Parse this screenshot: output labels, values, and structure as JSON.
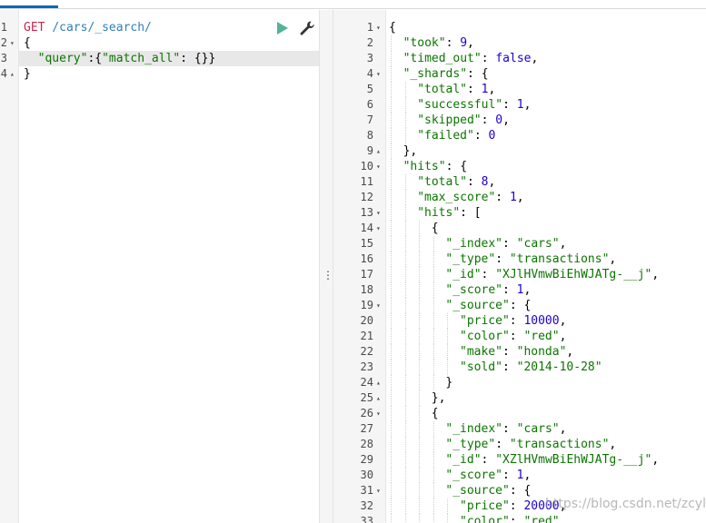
{
  "request_editor": {
    "lines": [
      {
        "num": "1",
        "fold": "",
        "tokens": [
          {
            "t": "GET ",
            "c": "tk-method"
          },
          {
            "t": "/cars/_search/",
            "c": "tk-url"
          }
        ]
      },
      {
        "num": "2",
        "fold": "▾",
        "tokens": [
          {
            "t": "{",
            "c": "tk-punct"
          }
        ]
      },
      {
        "num": "3",
        "fold": "",
        "active": true,
        "tokens": [
          {
            "t": "  ",
            "c": "tk-punct"
          },
          {
            "t": "\"query\"",
            "c": "tk-key"
          },
          {
            "t": ":{",
            "c": "tk-punct"
          },
          {
            "t": "\"match_all\"",
            "c": "tk-key"
          },
          {
            "t": ": {}}",
            "c": "tk-punct"
          }
        ]
      },
      {
        "num": "4",
        "fold": "▴",
        "tokens": [
          {
            "t": "}",
            "c": "tk-punct"
          }
        ]
      }
    ]
  },
  "toolbar": {
    "run_icon": "play-icon",
    "settings_icon": "wrench-icon",
    "run_color": "#54b399"
  },
  "response_viewer": {
    "lines": [
      {
        "num": "1",
        "fold": "▾",
        "indent": 0,
        "tokens": [
          {
            "t": "{",
            "c": "tk-punct"
          }
        ]
      },
      {
        "num": "2",
        "fold": "",
        "indent": 1,
        "tokens": [
          {
            "t": "\"took\"",
            "c": "tk-key"
          },
          {
            "t": ": ",
            "c": "tk-punct"
          },
          {
            "t": "9",
            "c": "tk-num"
          },
          {
            "t": ",",
            "c": "tk-punct"
          }
        ]
      },
      {
        "num": "3",
        "fold": "",
        "indent": 1,
        "tokens": [
          {
            "t": "\"timed_out\"",
            "c": "tk-key"
          },
          {
            "t": ": ",
            "c": "tk-punct"
          },
          {
            "t": "false",
            "c": "tk-bool"
          },
          {
            "t": ",",
            "c": "tk-punct"
          }
        ]
      },
      {
        "num": "4",
        "fold": "▾",
        "indent": 1,
        "tokens": [
          {
            "t": "\"_shards\"",
            "c": "tk-key"
          },
          {
            "t": ": {",
            "c": "tk-punct"
          }
        ]
      },
      {
        "num": "5",
        "fold": "",
        "indent": 2,
        "tokens": [
          {
            "t": "\"total\"",
            "c": "tk-key"
          },
          {
            "t": ": ",
            "c": "tk-punct"
          },
          {
            "t": "1",
            "c": "tk-num"
          },
          {
            "t": ",",
            "c": "tk-punct"
          }
        ]
      },
      {
        "num": "6",
        "fold": "",
        "indent": 2,
        "tokens": [
          {
            "t": "\"successful\"",
            "c": "tk-key"
          },
          {
            "t": ": ",
            "c": "tk-punct"
          },
          {
            "t": "1",
            "c": "tk-num"
          },
          {
            "t": ",",
            "c": "tk-punct"
          }
        ]
      },
      {
        "num": "7",
        "fold": "",
        "indent": 2,
        "tokens": [
          {
            "t": "\"skipped\"",
            "c": "tk-key"
          },
          {
            "t": ": ",
            "c": "tk-punct"
          },
          {
            "t": "0",
            "c": "tk-num"
          },
          {
            "t": ",",
            "c": "tk-punct"
          }
        ]
      },
      {
        "num": "8",
        "fold": "",
        "indent": 2,
        "tokens": [
          {
            "t": "\"failed\"",
            "c": "tk-key"
          },
          {
            "t": ": ",
            "c": "tk-punct"
          },
          {
            "t": "0",
            "c": "tk-num"
          }
        ]
      },
      {
        "num": "9",
        "fold": "▴",
        "indent": 1,
        "tokens": [
          {
            "t": "},",
            "c": "tk-punct"
          }
        ]
      },
      {
        "num": "10",
        "fold": "▾",
        "indent": 1,
        "tokens": [
          {
            "t": "\"hits\"",
            "c": "tk-key"
          },
          {
            "t": ": {",
            "c": "tk-punct"
          }
        ]
      },
      {
        "num": "11",
        "fold": "",
        "indent": 2,
        "tokens": [
          {
            "t": "\"total\"",
            "c": "tk-key"
          },
          {
            "t": ": ",
            "c": "tk-punct"
          },
          {
            "t": "8",
            "c": "tk-num"
          },
          {
            "t": ",",
            "c": "tk-punct"
          }
        ]
      },
      {
        "num": "12",
        "fold": "",
        "indent": 2,
        "tokens": [
          {
            "t": "\"max_score\"",
            "c": "tk-key"
          },
          {
            "t": ": ",
            "c": "tk-punct"
          },
          {
            "t": "1",
            "c": "tk-num"
          },
          {
            "t": ",",
            "c": "tk-punct"
          }
        ]
      },
      {
        "num": "13",
        "fold": "▾",
        "indent": 2,
        "tokens": [
          {
            "t": "\"hits\"",
            "c": "tk-key"
          },
          {
            "t": ": [",
            "c": "tk-punct"
          }
        ]
      },
      {
        "num": "14",
        "fold": "▾",
        "indent": 3,
        "tokens": [
          {
            "t": "{",
            "c": "tk-punct"
          }
        ]
      },
      {
        "num": "15",
        "fold": "",
        "indent": 4,
        "tokens": [
          {
            "t": "\"_index\"",
            "c": "tk-key"
          },
          {
            "t": ": ",
            "c": "tk-punct"
          },
          {
            "t": "\"cars\"",
            "c": "tk-str"
          },
          {
            "t": ",",
            "c": "tk-punct"
          }
        ]
      },
      {
        "num": "16",
        "fold": "",
        "indent": 4,
        "tokens": [
          {
            "t": "\"_type\"",
            "c": "tk-key"
          },
          {
            "t": ": ",
            "c": "tk-punct"
          },
          {
            "t": "\"transactions\"",
            "c": "tk-str"
          },
          {
            "t": ",",
            "c": "tk-punct"
          }
        ]
      },
      {
        "num": "17",
        "fold": "",
        "indent": 4,
        "tokens": [
          {
            "t": "\"_id\"",
            "c": "tk-key"
          },
          {
            "t": ": ",
            "c": "tk-punct"
          },
          {
            "t": "\"XJlHVmwBiEhWJATg-__j\"",
            "c": "tk-str"
          },
          {
            "t": ",",
            "c": "tk-punct"
          }
        ]
      },
      {
        "num": "18",
        "fold": "",
        "indent": 4,
        "tokens": [
          {
            "t": "\"_score\"",
            "c": "tk-key"
          },
          {
            "t": ": ",
            "c": "tk-punct"
          },
          {
            "t": "1",
            "c": "tk-num"
          },
          {
            "t": ",",
            "c": "tk-punct"
          }
        ]
      },
      {
        "num": "19",
        "fold": "▾",
        "indent": 4,
        "tokens": [
          {
            "t": "\"_source\"",
            "c": "tk-key"
          },
          {
            "t": ": {",
            "c": "tk-punct"
          }
        ]
      },
      {
        "num": "20",
        "fold": "",
        "indent": 5,
        "tokens": [
          {
            "t": "\"price\"",
            "c": "tk-key"
          },
          {
            "t": ": ",
            "c": "tk-punct"
          },
          {
            "t": "10000",
            "c": "tk-num"
          },
          {
            "t": ",",
            "c": "tk-punct"
          }
        ]
      },
      {
        "num": "21",
        "fold": "",
        "indent": 5,
        "tokens": [
          {
            "t": "\"color\"",
            "c": "tk-key"
          },
          {
            "t": ": ",
            "c": "tk-punct"
          },
          {
            "t": "\"red\"",
            "c": "tk-str"
          },
          {
            "t": ",",
            "c": "tk-punct"
          }
        ]
      },
      {
        "num": "22",
        "fold": "",
        "indent": 5,
        "tokens": [
          {
            "t": "\"make\"",
            "c": "tk-key"
          },
          {
            "t": ": ",
            "c": "tk-punct"
          },
          {
            "t": "\"honda\"",
            "c": "tk-str"
          },
          {
            "t": ",",
            "c": "tk-punct"
          }
        ]
      },
      {
        "num": "23",
        "fold": "",
        "indent": 5,
        "tokens": [
          {
            "t": "\"sold\"",
            "c": "tk-key"
          },
          {
            "t": ": ",
            "c": "tk-punct"
          },
          {
            "t": "\"2014-10-28\"",
            "c": "tk-str"
          }
        ]
      },
      {
        "num": "24",
        "fold": "▴",
        "indent": 4,
        "tokens": [
          {
            "t": "}",
            "c": "tk-punct"
          }
        ]
      },
      {
        "num": "25",
        "fold": "▴",
        "indent": 3,
        "tokens": [
          {
            "t": "},",
            "c": "tk-punct"
          }
        ]
      },
      {
        "num": "26",
        "fold": "▾",
        "indent": 3,
        "tokens": [
          {
            "t": "{",
            "c": "tk-punct"
          }
        ]
      },
      {
        "num": "27",
        "fold": "",
        "indent": 4,
        "tokens": [
          {
            "t": "\"_index\"",
            "c": "tk-key"
          },
          {
            "t": ": ",
            "c": "tk-punct"
          },
          {
            "t": "\"cars\"",
            "c": "tk-str"
          },
          {
            "t": ",",
            "c": "tk-punct"
          }
        ]
      },
      {
        "num": "28",
        "fold": "",
        "indent": 4,
        "tokens": [
          {
            "t": "\"_type\"",
            "c": "tk-key"
          },
          {
            "t": ": ",
            "c": "tk-punct"
          },
          {
            "t": "\"transactions\"",
            "c": "tk-str"
          },
          {
            "t": ",",
            "c": "tk-punct"
          }
        ]
      },
      {
        "num": "29",
        "fold": "",
        "indent": 4,
        "tokens": [
          {
            "t": "\"_id\"",
            "c": "tk-key"
          },
          {
            "t": ": ",
            "c": "tk-punct"
          },
          {
            "t": "\"XZlHVmwBiEhWJATg-__j\"",
            "c": "tk-str"
          },
          {
            "t": ",",
            "c": "tk-punct"
          }
        ]
      },
      {
        "num": "30",
        "fold": "",
        "indent": 4,
        "tokens": [
          {
            "t": "\"_score\"",
            "c": "tk-key"
          },
          {
            "t": ": ",
            "c": "tk-punct"
          },
          {
            "t": "1",
            "c": "tk-num"
          },
          {
            "t": ",",
            "c": "tk-punct"
          }
        ]
      },
      {
        "num": "31",
        "fold": "▾",
        "indent": 4,
        "tokens": [
          {
            "t": "\"_source\"",
            "c": "tk-key"
          },
          {
            "t": ": {",
            "c": "tk-punct"
          }
        ]
      },
      {
        "num": "32",
        "fold": "",
        "indent": 5,
        "tokens": [
          {
            "t": "\"price\"",
            "c": "tk-key"
          },
          {
            "t": ": ",
            "c": "tk-punct"
          },
          {
            "t": "20000",
            "c": "tk-num"
          },
          {
            "t": ",",
            "c": "tk-punct"
          }
        ]
      },
      {
        "num": "33",
        "fold": "",
        "indent": 5,
        "tokens": [
          {
            "t": "\"color\"",
            "c": "tk-key"
          },
          {
            "t": ": ",
            "c": "tk-punct"
          },
          {
            "t": "\"red\"",
            "c": "tk-str"
          },
          {
            "t": ",",
            "c": "tk-punct"
          }
        ]
      }
    ]
  },
  "divider": {
    "handle_glyph": "⋮"
  },
  "watermark": {
    "text": "https://blog.csdn.net/zcylxzyh"
  }
}
